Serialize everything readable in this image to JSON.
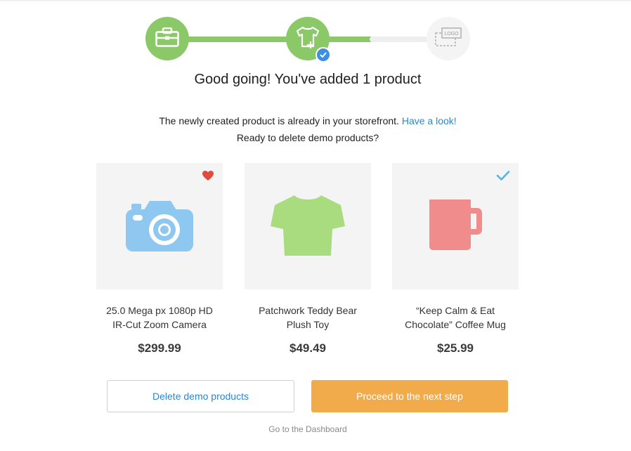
{
  "stepper": {
    "steps": [
      {
        "icon": "briefcase-icon",
        "state": "done"
      },
      {
        "icon": "tshirt-add-icon",
        "state": "current"
      },
      {
        "icon": "logo-placeholder-icon",
        "state": "todo",
        "label": "LOGO"
      }
    ],
    "colors": {
      "done": "#8bc867",
      "todo": "#eeeeee",
      "badge": "#3d8fe0"
    }
  },
  "heading": "Good going! You've added 1 product",
  "info": {
    "line1_text": "The newly created product is already in your storefront.",
    "line1_link": "Have a look!",
    "line2": "Ready to delete demo products?"
  },
  "products": [
    {
      "name_line1": "25.0 Mega px 1080p HD",
      "name_line2": "IR-Cut Zoom Camera",
      "price": "$299.99",
      "icon": "camera-icon",
      "badge": "heart-icon"
    },
    {
      "name_line1": "Patchwork Teddy Bear",
      "name_line2": "Plush Toy",
      "price": "$49.49",
      "icon": "tshirt-icon"
    },
    {
      "name_line1": "“Keep Calm & Eat",
      "name_line2": "Chocolate” Coffee Mug",
      "price": "$25.99",
      "icon": "mug-icon",
      "badge": "checkmark-icon"
    }
  ],
  "actions": {
    "delete_label": "Delete demo products",
    "next_label": "Proceed to the next step",
    "dashboard_label": "Go to the Dashboard"
  },
  "colors": {
    "link": "#2b87d1",
    "primary_button": "#f1ab4a",
    "heart": "#e04a3f",
    "check": "#4fb6e8"
  }
}
